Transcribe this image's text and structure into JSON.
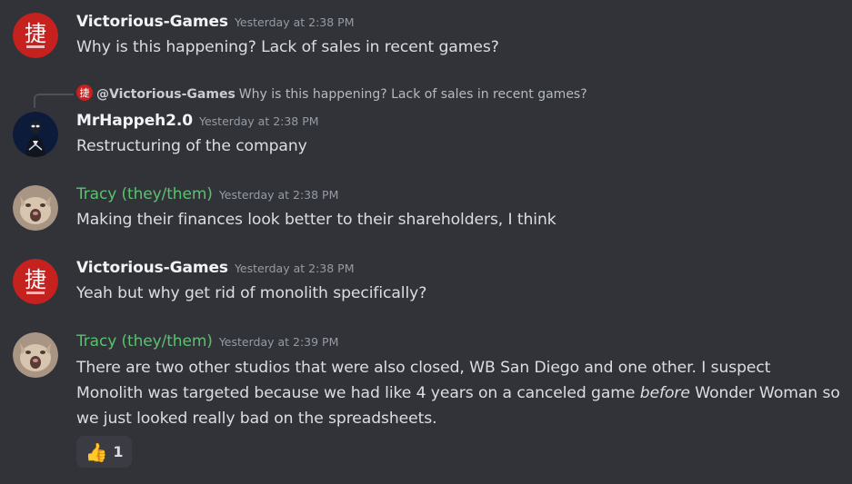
{
  "messages": [
    {
      "author": "Victorious-Games",
      "timestamp": "Yesterday at 2:38 PM",
      "text": "Why is this happening? Lack of sales in recent games?"
    },
    {
      "reply": {
        "author": "@Victorious-Games",
        "text": "Why is this happening? Lack of sales in recent games?"
      },
      "author": "MrHappeh2.0",
      "timestamp": "Yesterday at 2:38 PM",
      "text": "Restructuring of the company"
    },
    {
      "author": "Tracy (they/them)",
      "timestamp": "Yesterday at 2:38 PM",
      "text": "Making their finances look better to their shareholders, I think"
    },
    {
      "author": "Victorious-Games",
      "timestamp": "Yesterday at 2:38 PM",
      "text": "Yeah but why get rid of monolith specifically?"
    },
    {
      "author": "Tracy (they/them)",
      "timestamp": "Yesterday at 2:39 PM",
      "line1": "There are two other studios that were also closed, WB San Diego and one other. I suspect",
      "line2_before": "Monolith was targeted because we had like 4 years on a canceled game ",
      "line2_italic": "before",
      "line2_after": " Wonder Woman so",
      "line3": "we just looked really bad on the spreadsheets.",
      "reaction": {
        "emoji": "👍",
        "count": "1"
      }
    }
  ],
  "colors": {
    "background": "#323339",
    "tracy_name": "#5ac26f",
    "username": "#f2f3f5",
    "timestamp": "#949ba4",
    "victorious_avatar": "#c4211f"
  },
  "icons": {
    "victorious_avatar": "red-circle-kanji-logo",
    "mrhappeh_avatar": "dark-figure-avatar",
    "tracy_avatar": "cat-photo-avatar",
    "reaction": "thumbs-up-emoji"
  }
}
